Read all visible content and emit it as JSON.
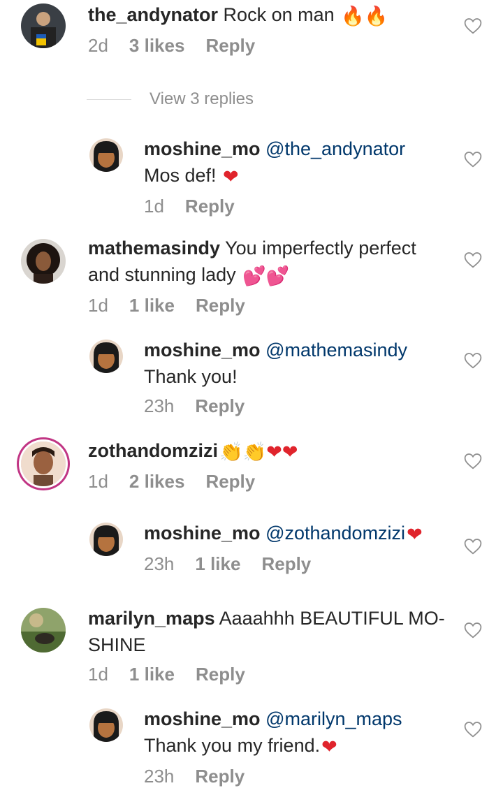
{
  "comments": [
    {
      "user": "the_andynator",
      "text": " Rock on man ",
      "emoji": "🔥🔥",
      "time": "2d",
      "likes": "3 likes",
      "reply": "Reply"
    },
    {
      "view_replies": "View 3 replies"
    },
    {
      "user": "moshine_mo",
      "mention": "@the_andynator",
      "text": "Mos def! ",
      "emoji": "❤",
      "time": "1d",
      "reply": "Reply"
    },
    {
      "user": "mathemasindy",
      "text": " You imperfectly perfect and stunning lady ",
      "emoji": "💕💕",
      "time": "1d",
      "likes": "1 like",
      "reply": "Reply"
    },
    {
      "user": "moshine_mo",
      "mention": "@mathemasindy",
      "text": "Thank you!",
      "time": "23h",
      "reply": "Reply"
    },
    {
      "user": "zothandomzizi",
      "emoji": " 👏👏❤❤",
      "time": "1d",
      "likes": "2 likes",
      "reply": "Reply"
    },
    {
      "user": "moshine_mo",
      "mention": "@zothandomzizi",
      "emoji": " ❤",
      "time": "23h",
      "likes": "1 like",
      "reply": "Reply"
    },
    {
      "user": "marilyn_maps",
      "text": " Aaaahhh BEAUTIFUL MO-SHINE",
      "time": "1d",
      "likes": "1 like",
      "reply": "Reply"
    },
    {
      "user": "moshine_mo",
      "mention": "@marilyn_maps",
      "text": "Thank you my friend.",
      "emoji": "❤",
      "time": "23h",
      "reply": "Reply"
    }
  ],
  "icons": {
    "like": "heart-outline-icon",
    "fire": "fire-emoji",
    "heart": "red-heart-emoji",
    "clap": "clapping-hands-emoji",
    "two_hearts": "two-hearts-emoji"
  },
  "colors": {
    "mention": "#00376b",
    "meta": "#8e8e8e",
    "heart": "#e0242c",
    "story_ring": "#c13584"
  }
}
